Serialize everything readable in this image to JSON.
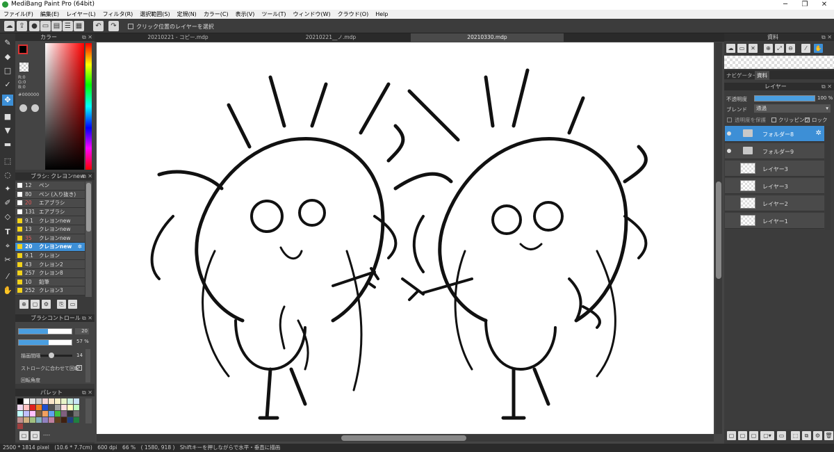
{
  "window": {
    "title": "MediBang Paint Pro (64bit)",
    "minimize": "─",
    "maximize": "❐",
    "close": "✕"
  },
  "menu": [
    "ファイル(F)",
    "編集(E)",
    "レイヤー(L)",
    "フィルタ(R)",
    "選択範囲(S)",
    "定規(N)",
    "カラー(C)",
    "表示(V)",
    "ツール(T)",
    "ウィンドウ(W)",
    "クラウド(O)",
    "Help"
  ],
  "toolbar": {
    "select_layer_checkbox": "クリック位置のレイヤーを選択"
  },
  "color_panel": {
    "title": "カラー",
    "r": "R:0",
    "g": "G:0",
    "b": "B:0",
    "hex": "#000000"
  },
  "brush_panel": {
    "title": "ブラシ: クレヨンnew",
    "items": [
      {
        "size": "12",
        "name": "ペン",
        "color": "#ffffff",
        "size_color": "#ddd"
      },
      {
        "size": "80",
        "name": "ペン (入り抜き)",
        "color": "#ffffff",
        "size_color": "#ddd"
      },
      {
        "size": "20",
        "name": "エアブラシ",
        "color": "#ffffff",
        "size_color": "#e65a5a"
      },
      {
        "size": "131",
        "name": "エアブラシ",
        "color": "#ffffff",
        "size_color": "#ddd"
      },
      {
        "size": "9.1",
        "name": "クレヨンnew",
        "color": "#f2d21a",
        "size_color": "#ddd"
      },
      {
        "size": "13",
        "name": "クレヨンnew",
        "color": "#f2d21a",
        "size_color": "#ddd"
      },
      {
        "size": "35",
        "name": "クレヨンnew",
        "color": "#f2d21a",
        "size_color": "#e65a5a"
      },
      {
        "size": "20",
        "name": "クレヨンnew",
        "color": "#f2d21a",
        "size_color": "#fff",
        "selected": true
      },
      {
        "size": "9.1",
        "name": "クレヨン",
        "color": "#f2d21a",
        "size_color": "#ddd"
      },
      {
        "size": "43",
        "name": "クレヨン2",
        "color": "#f2d21a",
        "size_color": "#ddd"
      },
      {
        "size": "257",
        "name": "クレヨン8",
        "color": "#f2d21a",
        "size_color": "#ddd"
      },
      {
        "size": "10",
        "name": "鉛筆",
        "color": "#f2d21a",
        "size_color": "#ddd"
      },
      {
        "size": "252",
        "name": "クレヨン3",
        "color": "#f2d21a",
        "size_color": "#ddd"
      }
    ]
  },
  "brush_control": {
    "title": "ブラシコントロール",
    "size_value": "20",
    "size_fill": 0.55,
    "opacity_value": "57",
    "opacity_unit": "%",
    "opacity_fill": 0.57,
    "spacing_label": "描画間隔",
    "spacing_value": "14",
    "stroke_rotate_label": "ストロークに合わせて回転",
    "rotation_label": "回転角度"
  },
  "palette": {
    "title": "パレット",
    "footer_text": "----",
    "colors": [
      "#000000",
      "#ffffff",
      "#e0e0e0",
      "#c8c8c8",
      "#f4d4d4",
      "#f8e4c8",
      "#f8f0c8",
      "#e8f4c8",
      "#c8f0e0",
      "#c8e4f8",
      "#f0d8f0",
      "#ffc0c0",
      "#e02020",
      "#f08020",
      "#2050d0",
      "#505050",
      "#a0a0a0",
      "#ffe0e0",
      "#ffffc0",
      "#c0ffc0",
      "#c0ffff",
      "#c0c0ff",
      "#ffc0ff",
      "#806040",
      "#f0a060",
      "#60a0f0",
      "#40c040",
      "#806080",
      "#303030",
      "#707070",
      "#c09090",
      "#d0b080",
      "#a0c080",
      "#80b0c0",
      "#9080c0",
      "#c080a0",
      "#604020",
      "#402010",
      "#204080",
      "#208040",
      "#a04040"
    ]
  },
  "tabs": [
    "20210221 - コピー.mdp",
    "20210221__ノ.mdp",
    "20210330.mdp"
  ],
  "status": "2500 * 1814 pixel　(10.6 * 7.7cm)　600 dpi　66 %　( 1580, 918 )　Shiftキーを押しながらで水平・垂直に描画",
  "material_panel": {
    "title": "資料",
    "tab_navigator": "ナビゲーター",
    "tab_material": "資料"
  },
  "layer_panel": {
    "title": "レイヤー",
    "opacity_label": "不透明度",
    "opacity_value": "100",
    "opacity_unit": "%",
    "opacity_fill": 1.0,
    "blend_label": "ブレンド",
    "blend_value": "通過",
    "protect_label": "透明度を保護",
    "clipping_label": "クリッピング",
    "lock_label": "ロック",
    "layers": [
      {
        "name": "フォルダー8",
        "type": "folder",
        "selected": true,
        "visible": true
      },
      {
        "name": "フォルダー9",
        "type": "folder",
        "selected": false,
        "visible": true
      },
      {
        "name": "レイヤー3",
        "type": "layer",
        "selected": false,
        "visible": false
      },
      {
        "name": "レイヤー3",
        "type": "layer",
        "selected": false,
        "visible": false
      },
      {
        "name": "レイヤー2",
        "type": "layer",
        "selected": false,
        "visible": false
      },
      {
        "name": "レイヤー1",
        "type": "layer",
        "selected": false,
        "visible": false
      }
    ]
  }
}
